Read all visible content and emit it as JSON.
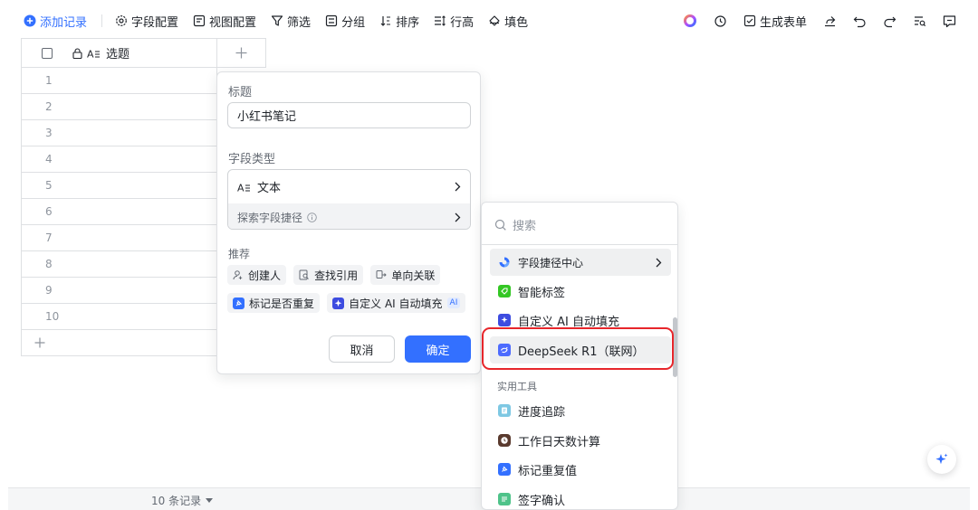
{
  "toolbar": {
    "add_record": "添加记录",
    "field_config": "字段配置",
    "view_config": "视图配置",
    "filter": "筛选",
    "group": "分组",
    "sort": "排序",
    "row_height": "行高",
    "fill_color": "填色",
    "generate_form": "生成表单"
  },
  "grid": {
    "column_title": "选题",
    "rows": [
      "1",
      "2",
      "3",
      "4",
      "5",
      "6",
      "7",
      "8",
      "9",
      "10"
    ],
    "record_count": "10 条记录"
  },
  "field_panel": {
    "title_label": "标题",
    "title_value": "小红书笔记",
    "type_label": "字段类型",
    "type_value": "文本",
    "explore_shortcut": "探索字段捷径",
    "recommend_label": "推荐",
    "chips": [
      "创建人",
      "查找引用",
      "单向关联",
      "标记是否重复",
      "自定义 AI 自动填充"
    ],
    "ai_badge": "AI",
    "cancel": "取消",
    "confirm": "确定"
  },
  "dropdown": {
    "search_placeholder": "搜索",
    "shortcut_center": "字段捷径中心",
    "items": [
      "智能标签",
      "自定义 AI 自动填充",
      "DeepSeek R1（联网）"
    ],
    "section_tools": "实用工具",
    "tools": [
      "进度追踪",
      "工作日天数计算",
      "标记重复值",
      "签字确认"
    ]
  },
  "colors": {
    "accent": "#3370ff",
    "highlight_border": "#e7262b"
  }
}
